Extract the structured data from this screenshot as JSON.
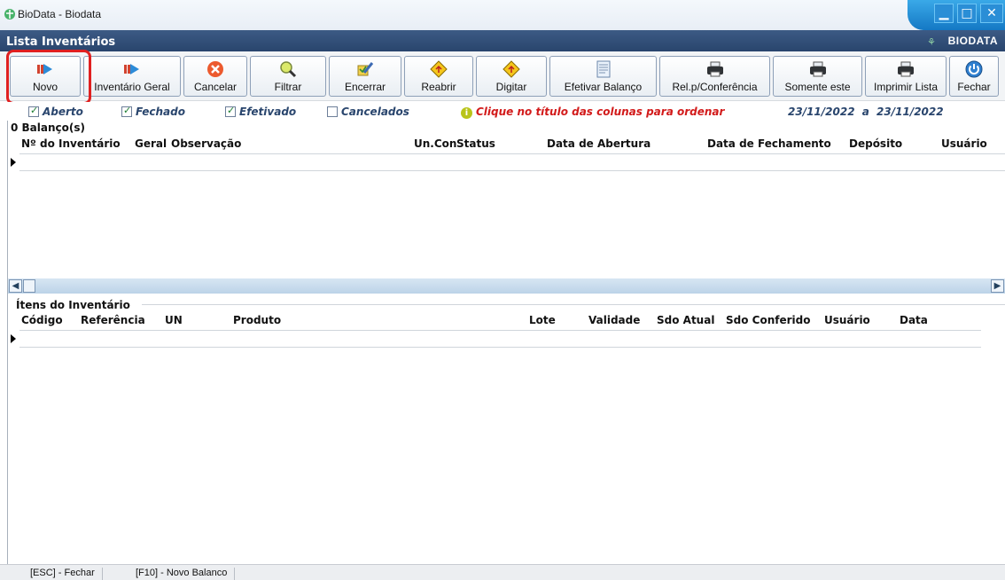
{
  "window": {
    "title": "BioData - Biodata",
    "header_title": "Lista Inventários",
    "brand": "BIODATA"
  },
  "toolbar": {
    "buttons": [
      {
        "label": "Novo",
        "icon": "arrow-right-icon"
      },
      {
        "label": "Inventário Geral",
        "icon": "arrow-right-icon"
      },
      {
        "label": "Cancelar",
        "icon": "cancel-x-icon"
      },
      {
        "label": "Filtrar",
        "icon": "magnifier-icon"
      },
      {
        "label": "Encerrar",
        "icon": "pen-check-icon"
      },
      {
        "label": "Reabrir",
        "icon": "warning-diamond-icon"
      },
      {
        "label": "Digitar",
        "icon": "warning-diamond-icon"
      },
      {
        "label": "Efetivar Balanço",
        "icon": "document-icon"
      },
      {
        "label": "Rel.p/Conferência",
        "icon": "printer-icon"
      },
      {
        "label": "Somente este",
        "icon": "printer-icon"
      },
      {
        "label": "Imprimir Lista",
        "icon": "printer-icon"
      },
      {
        "label": "Fechar",
        "icon": "power-icon"
      }
    ]
  },
  "filters": {
    "aberto": {
      "label": "Aberto",
      "checked": true
    },
    "fechado": {
      "label": "Fechado",
      "checked": true
    },
    "efetivado": {
      "label": "Efetivado",
      "checked": true
    },
    "cancelados": {
      "label": "Cancelados",
      "checked": false
    },
    "hint": "Clique no título das colunas para ordenar",
    "date_from": "23/11/2022",
    "date_sep": "a",
    "date_to": "23/11/2022"
  },
  "balancos": {
    "caption": "0 Balanço(s)",
    "columns": [
      "Nº do Inventário",
      "Geral",
      "Observação",
      "Un.Con",
      "Status",
      "Data de Abertura",
      "Data de Fechamento",
      "Depósito",
      "Usuário"
    ]
  },
  "itens": {
    "caption": "Ítens do Inventário",
    "columns": [
      "Código",
      "Referência",
      "UN",
      "Produto",
      "Lote",
      "Validade",
      "Sdo Atual",
      "Sdo Conferido",
      "Usuário",
      "Data"
    ]
  },
  "statusbar": {
    "items": [
      "[ESC] - Fechar",
      "[F10] - Novo Balanco"
    ]
  },
  "colors": {
    "header_bg": "#29456d",
    "accent_blue": "#1478c4",
    "hint_red": "#d21a1a",
    "highlight_red": "#e02020"
  }
}
